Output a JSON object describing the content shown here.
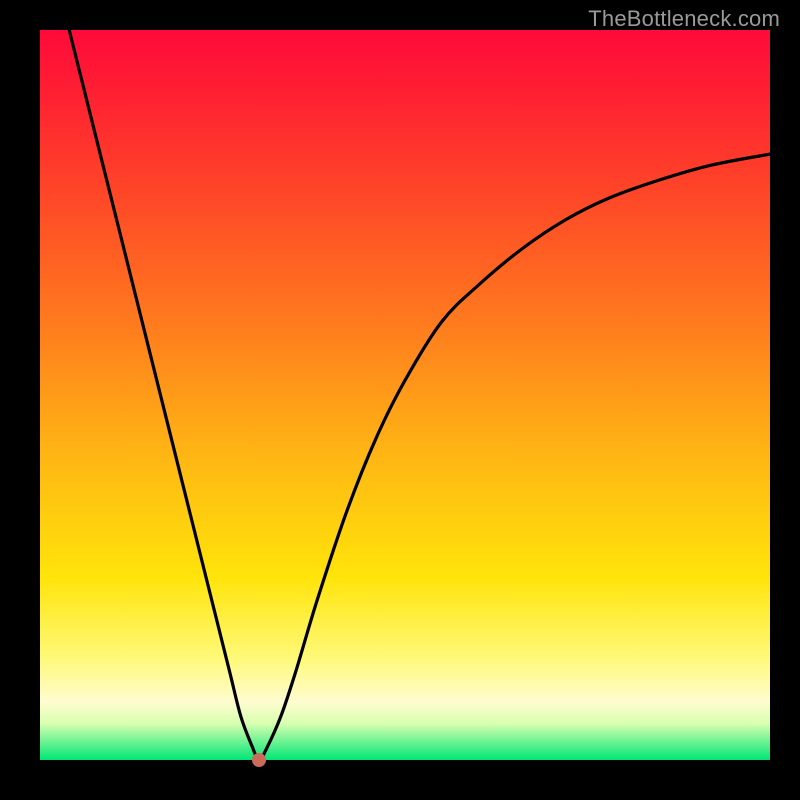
{
  "watermark": "TheBottleneck.com",
  "chart_data": {
    "type": "line",
    "title": "",
    "xlabel": "",
    "ylabel": "",
    "xlim": [
      0,
      100
    ],
    "ylim": [
      0,
      100
    ],
    "series": [
      {
        "name": "bottleneck-curve",
        "x": [
          4,
          6,
          8,
          10,
          12,
          14,
          16,
          18,
          20,
          22,
          24,
          26,
          27.5,
          29,
          30,
          31,
          33,
          35,
          38,
          42,
          46,
          50,
          55,
          60,
          66,
          72,
          78,
          85,
          92,
          100
        ],
        "values": [
          100,
          92,
          84,
          76,
          68,
          60,
          52,
          44,
          36,
          28,
          20,
          12,
          6,
          2,
          0,
          1.5,
          6,
          12,
          22,
          34,
          44,
          52,
          60,
          65,
          70,
          74,
          77,
          79.5,
          81.5,
          83
        ]
      }
    ],
    "annotations": [
      {
        "name": "min-marker",
        "x": 30,
        "y": 0
      }
    ],
    "background_gradient": {
      "stops": [
        {
          "pct": 0,
          "color": "#ff0a3a"
        },
        {
          "pct": 40,
          "color": "#ff7a1e"
        },
        {
          "pct": 75,
          "color": "#ffe40a"
        },
        {
          "pct": 92,
          "color": "#fffccf"
        },
        {
          "pct": 100,
          "color": "#00e676"
        }
      ]
    }
  }
}
